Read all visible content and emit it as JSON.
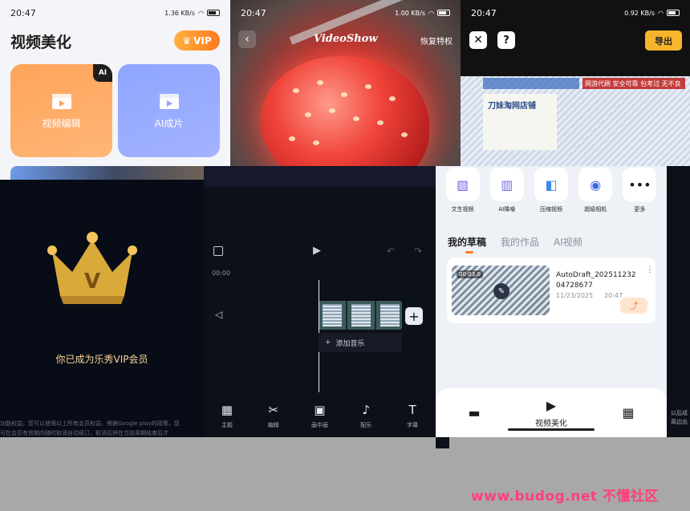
{
  "status": {
    "time": "20:47",
    "speed_a": "1.36 KB/s",
    "speed_b": "1.00 KB/s",
    "speed_c": "0.92 KB/s",
    "battery_a": "88",
    "battery_b": "87",
    "battery_c": "85"
  },
  "home": {
    "title": "视频美化",
    "vip_label": "VIP",
    "card_edit": "视频编辑",
    "card_ai": "AI成片",
    "ai_tag": "AI"
  },
  "splash": {
    "brand": "VideoShow",
    "restore": "恢复特权"
  },
  "editor_top": {
    "export": "导出",
    "help": "?",
    "banner_text": "网游代刷 安全可靠 包考过 无不良",
    "doc_title": "刀妹淘网店铺"
  },
  "vip": {
    "message": "你已成为乐秀VIP会员",
    "fine_print_1": "功能权益，您可以使用以上所有会员权益，根据Google play的政策，您",
    "fine_print_2": "可在会员有效期内随时取消自动续订，取消后将在当前周期结束后才"
  },
  "timeline": {
    "time_code": "00:00",
    "add_music": "添加音乐",
    "tools": [
      {
        "icon": "grid",
        "label": "主题"
      },
      {
        "icon": "scissors",
        "label": "编辑"
      },
      {
        "icon": "pip",
        "label": "画中画"
      },
      {
        "icon": "note",
        "label": "配乐"
      },
      {
        "icon": "text",
        "label": "字幕"
      }
    ]
  },
  "drafts": {
    "quick": [
      {
        "label": "文生视频"
      },
      {
        "label": "AI降噪"
      },
      {
        "label": "压缩视频"
      },
      {
        "label": "超级相机"
      },
      {
        "label": "更多"
      }
    ],
    "tabs": [
      "我的草稿",
      "我的作品",
      "AI视频"
    ],
    "item": {
      "duration": "00:03.0",
      "name": "AutoDraft_20251123204728677",
      "date": "11/23/2025",
      "time": "20:47"
    },
    "nav": {
      "center_label": "视频美化"
    }
  },
  "edge": {
    "text_1": "以后成",
    "text_2": "周边出"
  },
  "watermark": "www.budog.net 不懂社区",
  "colors": {
    "vip_orange": "#ff7a1f",
    "export_yellow": "#f7b52c",
    "vip_gold": "#ffc979",
    "watermark_pink": "#ff3f7a"
  }
}
